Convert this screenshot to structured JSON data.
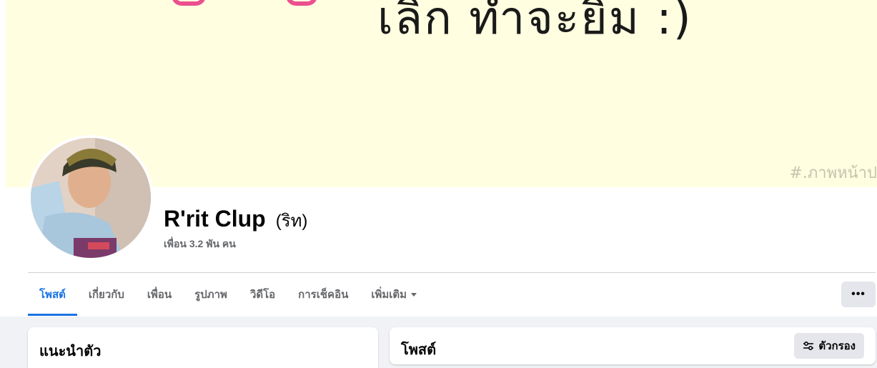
{
  "profile": {
    "name": "R'rit Clup",
    "alternate_name": "(ริท)",
    "friends_text": "เพื่อน 3.2 พัน คน"
  },
  "cover": {
    "text": "เลิก ทำจะยิม :)",
    "hashtag": "#.ภาพหน้าป"
  },
  "tabs": [
    {
      "label": "โพสต์",
      "active": true
    },
    {
      "label": "เกี่ยวกับ",
      "active": false
    },
    {
      "label": "เพื่อน",
      "active": false
    },
    {
      "label": "รูปภาพ",
      "active": false
    },
    {
      "label": "วิดีโอ",
      "active": false
    },
    {
      "label": "การเช็คอิน",
      "active": false
    },
    {
      "label": "เพิ่มเติม",
      "active": false
    }
  ],
  "more_button": {
    "label": "•••"
  },
  "intro": {
    "title": "แนะนำตัว"
  },
  "posts": {
    "title": "โพสต์",
    "filter_label": "ตัวกรอง"
  },
  "colors": {
    "accent": "#1b74e4",
    "cover_bg": "#fffee0",
    "page_bg": "#f0f2f5"
  }
}
